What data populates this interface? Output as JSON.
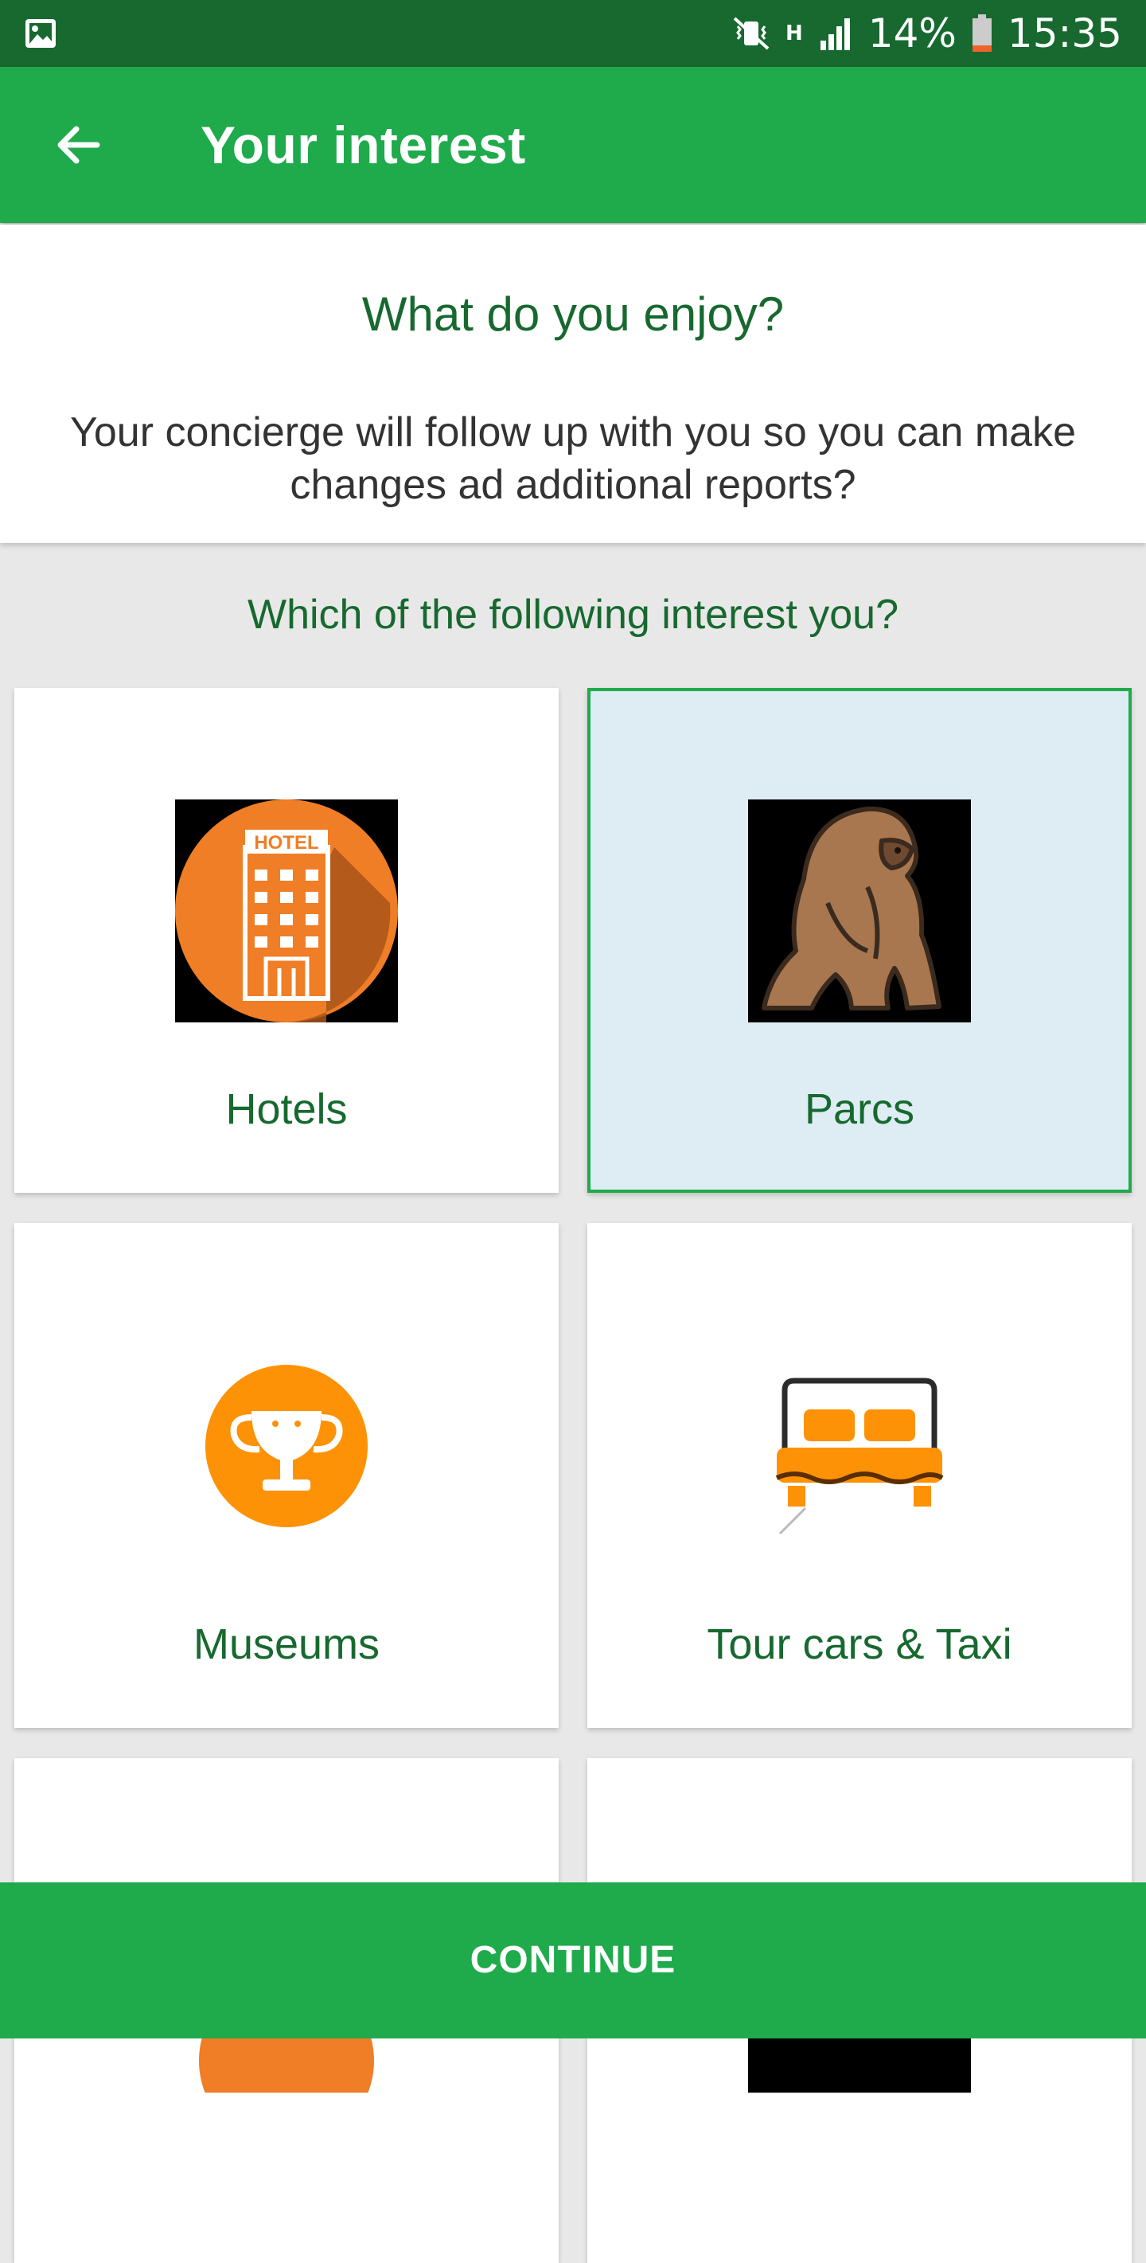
{
  "status_bar": {
    "battery": "14%",
    "time": "15:35",
    "network_type": "H"
  },
  "app_bar": {
    "title": "Your interest"
  },
  "intro": {
    "title": "What do you enjoy?",
    "subtitle": "Your concierge will follow up with you so you can make changes ad additional reports?"
  },
  "question": "Which of the following interest you?",
  "tiles": [
    {
      "label": "Hotels",
      "icon": "hotel-building-icon",
      "selected": false,
      "icon_text": "HOTEL"
    },
    {
      "label": "Parcs",
      "icon": "gorilla-icon",
      "selected": true
    },
    {
      "label": "Museums",
      "icon": "trophy-icon",
      "selected": false
    },
    {
      "label": "Tour cars & Taxi",
      "icon": "bed-icon",
      "selected": false
    }
  ],
  "continue_label": "CONTINUE",
  "colors": {
    "primary": "#1faa4b",
    "primary_dark": "#17692f",
    "selected_bg": "#deecf3"
  }
}
